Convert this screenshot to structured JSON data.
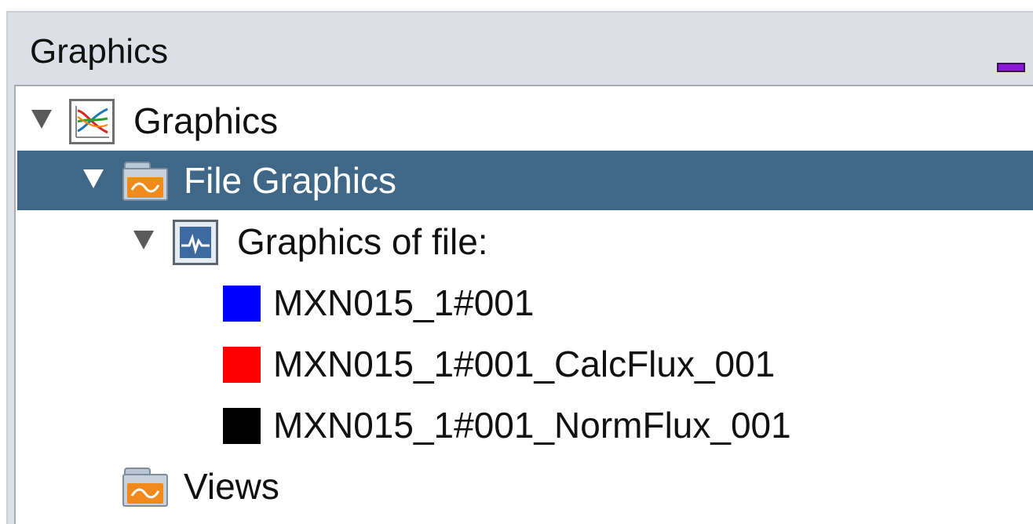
{
  "panel": {
    "title": "Graphics"
  },
  "tree": {
    "root": {
      "label": "Graphics",
      "icon": "graphics-chart-icon",
      "expanded": true
    },
    "file_graphics": {
      "label": "File Graphics",
      "icon": "folder-icon",
      "expanded": true,
      "selected": true
    },
    "graphics_of_file": {
      "label": "Graphics of file:",
      "icon": "waveform-chart-icon",
      "expanded": true
    },
    "items": [
      {
        "label": "MXN015_1#001",
        "color": "#0000ff"
      },
      {
        "label": "MXN015_1#001_CalcFlux_001",
        "color": "#ff0000"
      },
      {
        "label": "MXN015_1#001_NormFlux_001",
        "color": "#000000"
      }
    ],
    "views": {
      "label": "Views",
      "icon": "folder-icon"
    }
  },
  "colors": {
    "selection": "#3f6888",
    "header_bg": "#dcdfe5",
    "minimize_accent": "#8a18d6"
  }
}
